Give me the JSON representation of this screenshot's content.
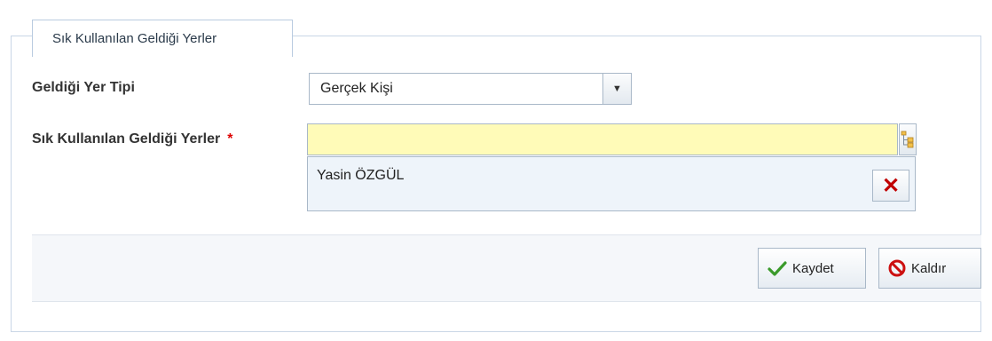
{
  "fieldset": {
    "legend": "Sık Kullanılan Geldiği Yerler"
  },
  "fields": {
    "type_label": "Geldiği Yer Tipi",
    "type_value": "Gerçek Kişi",
    "favorites_label": "Sık Kullanılan Geldiği Yerler",
    "required_mark": "*",
    "favorites_input_value": ""
  },
  "selected": {
    "items": [
      "Yasin ÖZGÜL"
    ]
  },
  "toolbar": {
    "save_label": "Kaydet",
    "remove_label": "Kaldır"
  },
  "colors": {
    "lookup_input_bg": "#fffbb8",
    "required_mark": "#dd0000",
    "remove_x": "#c00000",
    "save_check": "#3a9a2a",
    "remove_icon": "#cc1010"
  },
  "icons": {
    "dropdown": "chevron-down-icon",
    "lookup": "tree-lookup-icon",
    "remove_item": "close-x-icon",
    "save": "checkmark-icon",
    "remove": "no-entry-icon"
  }
}
